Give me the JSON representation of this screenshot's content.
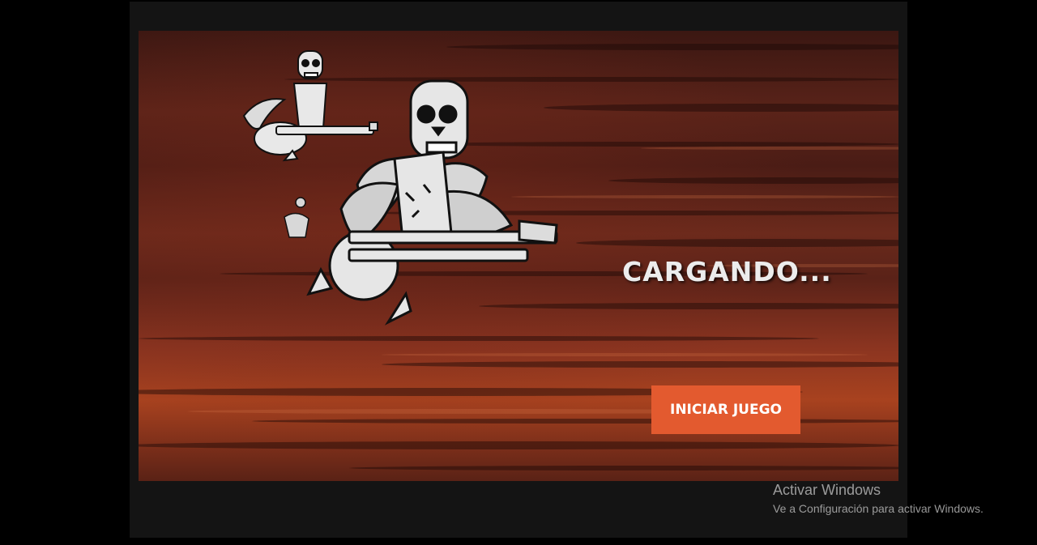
{
  "game": {
    "loading_text": "CARGANDO...",
    "start_button_label": "INICIAR JUEGO",
    "accent_color": "#e35a2f"
  },
  "artwork": {
    "subject": "skeletons with wings playing guitars"
  },
  "os_watermark": {
    "title": "Activar Windows",
    "subtitle": "Ve a Configuración para activar Windows."
  }
}
